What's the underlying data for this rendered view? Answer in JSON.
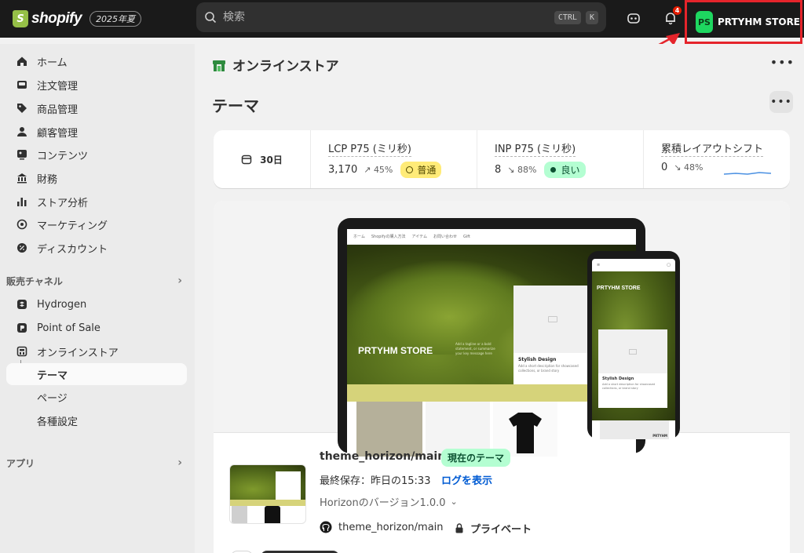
{
  "topbar": {
    "brand_name": "shopify",
    "brand_badge": "2025年夏",
    "search_placeholder": "検索",
    "kbd_ctrl": "CTRL",
    "kbd_k": "K",
    "notification_count": "4",
    "store_initials": "PS",
    "store_name": "PRTYHM STORE"
  },
  "colors": {
    "topbar": "#1a1a1a",
    "store_avatar": "#1ed760",
    "highlight_box": "#e5242b",
    "link": "#005bd3",
    "badge_good": "#b4fed2",
    "badge_warn": "#ffeb78"
  },
  "sidebar": {
    "items": [
      {
        "label": "ホーム",
        "icon": "home-icon"
      },
      {
        "label": "注文管理",
        "icon": "inbox-icon"
      },
      {
        "label": "商品管理",
        "icon": "tag-icon"
      },
      {
        "label": "顧客管理",
        "icon": "person-icon"
      },
      {
        "label": "コンテンツ",
        "icon": "image-icon"
      },
      {
        "label": "財務",
        "icon": "bank-icon"
      },
      {
        "label": "ストア分析",
        "icon": "bar-chart-icon"
      },
      {
        "label": "マーケティング",
        "icon": "target-icon"
      },
      {
        "label": "ディスカウント",
        "icon": "discount-icon"
      }
    ],
    "section_sales": "販売チャネル",
    "channels": [
      {
        "label": "Hydrogen",
        "icon": "hydrogen-icon"
      },
      {
        "label": "Point of Sale",
        "icon": "pos-icon"
      },
      {
        "label": "オンラインストア",
        "icon": "online-store-icon"
      }
    ],
    "sub_items": [
      "テーマ",
      "ページ",
      "各種設定"
    ],
    "section_apps": "アプリ"
  },
  "main": {
    "breadcrumb": "オンラインストア",
    "title": "テーマ",
    "metrics": {
      "period": "30日",
      "cells": [
        {
          "label": "LCP P75 (ミリ秒)",
          "value": "3,170",
          "delta": "45%",
          "badge": "普通"
        },
        {
          "label": "INP P75 (ミリ秒)",
          "value": "8",
          "delta": "88%",
          "badge": "良い"
        },
        {
          "label": "累積レイアウトシフト",
          "value": "0",
          "delta": "48%"
        }
      ]
    },
    "preview": {
      "laptop_nav": [
        "ホーム",
        "Shopifyの購入方法",
        "アイテム",
        "お問い合わせ",
        "Gift"
      ],
      "hero_title": "PRTYHM STORE",
      "hero_text": "Add a tagline or a bold statement, or summarize your key message here",
      "card_title": "Stylish Design",
      "card_text": "Add a short description for showcased collections, or brand story",
      "phone_title": "PRTYHM STORE",
      "phone_card_title": "Stylish Design",
      "phone_card_text": "Add a short description for showcased collections, or brand story",
      "phone_product": "PRTYHM"
    },
    "theme": {
      "name": "theme_horizon/main",
      "live_badge": "現在のテーマ",
      "saved": "最終保存：昨日の15:33",
      "log_link": "ログを表示",
      "version": "Horizonのバージョン1.0.0",
      "repo": "theme_horizon/main",
      "visibility": "プライベート"
    }
  }
}
